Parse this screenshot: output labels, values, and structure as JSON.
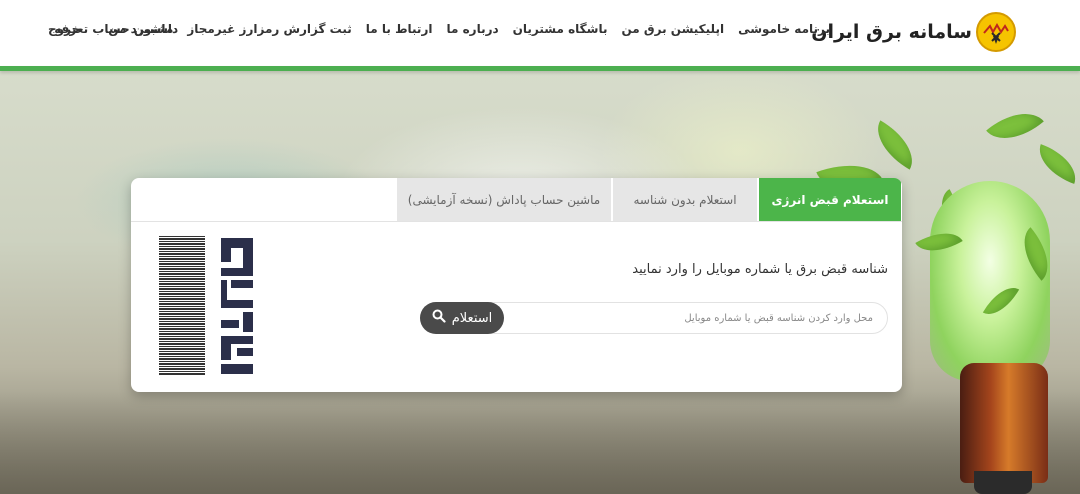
{
  "header": {
    "brand_title": "سامانه برق ایران",
    "nav": [
      "برنامه خاموشی",
      "اپلیکیشن برق من",
      "باشگاه مشتریان",
      "درباره ما",
      "ارتباط با ما",
      "ثبت گزارش رمزارز غیرمجاز",
      "ماشین حساب تعرفه"
    ],
    "nav_left": [
      "داشبورد من",
      "خروج"
    ]
  },
  "card": {
    "tabs": [
      {
        "label": "استعلام قبض انرژی",
        "active": true
      },
      {
        "label": "استعلام بدون شناسه",
        "active": false
      },
      {
        "label": "ماشین حساب پاداش (نسخه آزمایشی)",
        "active": false
      }
    ],
    "prompt": "شناسه قبض برق یا شماره موبایل را وارد نمایید",
    "search": {
      "placeholder": "محل وارد کردن شناسه قبض یا شماره موبایل",
      "value": "",
      "button_label": "استعلام",
      "button_icon": "search-icon"
    },
    "logo_icon": "bill-logo-icon"
  },
  "colors": {
    "accent_green": "#4cb54a",
    "header_bar": "#4caf50",
    "button_dark": "#4a4a4a",
    "logo_yellow": "#f6c400"
  }
}
